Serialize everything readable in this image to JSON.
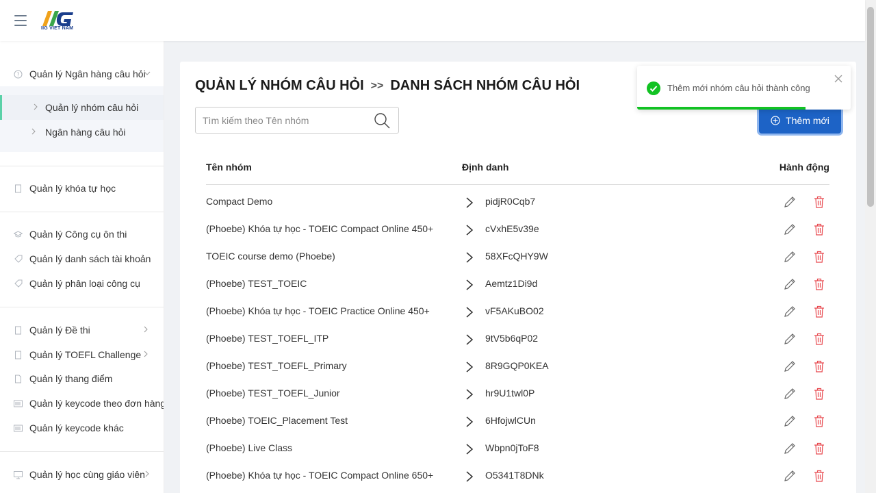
{
  "app": {
    "logo_text": "IIG VIET NAM"
  },
  "sidebar": {
    "group1": {
      "label": "Quản lý Ngân hàng câu hỏi"
    },
    "sub": [
      {
        "label": "Quản lý nhóm câu hỏi"
      },
      {
        "label": "Ngân hàng câu hỏi"
      }
    ],
    "items": [
      {
        "label": "Quản lý khóa tự học"
      },
      {
        "label": "Quản lý Công cụ ôn thi"
      },
      {
        "label": "Quản lý danh sách tài khoản"
      },
      {
        "label": "Quản lý phân loại công cụ"
      },
      {
        "label": "Quản lý Đề thi"
      },
      {
        "label": "Quản lý TOEFL Challenge"
      },
      {
        "label": "Quản lý thang điểm"
      },
      {
        "label": "Quản lý keycode theo đơn hàng"
      },
      {
        "label": "Quản lý keycode khác"
      },
      {
        "label": "Quản lý học cùng giáo viên"
      }
    ]
  },
  "page": {
    "breadcrumb_parent": "QUẢN LÝ NHÓM CÂU HỎI",
    "breadcrumb_sep": ">>",
    "breadcrumb_current": "DANH SÁCH NHÓM CÂU HỎI",
    "search_placeholder": "Tìm kiếm theo Tên nhóm",
    "add_label": "Thêm mới"
  },
  "table": {
    "headers": {
      "name": "Tên nhóm",
      "id": "Định danh",
      "action": "Hành động"
    },
    "rows": [
      {
        "name": "Compact Demo",
        "id": "pidjR0Cqb7"
      },
      {
        "name": "(Phoebe) Khóa tự học - TOEIC Compact Online 450+",
        "id": "cVxhE5v39e"
      },
      {
        "name": "TOEIC course demo (Phoebe)",
        "id": "58XFcQHY9W"
      },
      {
        "name": "(Phoebe) TEST_TOEIC",
        "id": "Aemtz1Di9d"
      },
      {
        "name": "(Phoebe) Khóa tự học - TOEIC Practice Online 450+",
        "id": "vF5AKuBO02"
      },
      {
        "name": "(Phoebe) TEST_TOEFL_ITP",
        "id": "9tV5b6qP02"
      },
      {
        "name": "(Phoebe) TEST_TOEFL_Primary",
        "id": "8R9GQP0KEA"
      },
      {
        "name": "(Phoebe) TEST_TOEFL_Junior",
        "id": "hr9U1twl0P"
      },
      {
        "name": "(Phoebe) TOEIC_Placement Test",
        "id": "6HfojwlCUn"
      },
      {
        "name": "(Phoebe) Live Class",
        "id": "Wbpn0jToF8"
      },
      {
        "name": "(Phoebe) Khóa tự học - TOEIC Compact Online 650+",
        "id": "O5341T8DNk"
      }
    ]
  },
  "toast": {
    "message": "Thêm mới nhóm câu hỏi thành công",
    "progress": 0.79
  },
  "colors": {
    "primary": "#1d63c6",
    "success": "#12c223",
    "delete": "#e8474d",
    "active_indicator": "#5bd1a8"
  }
}
